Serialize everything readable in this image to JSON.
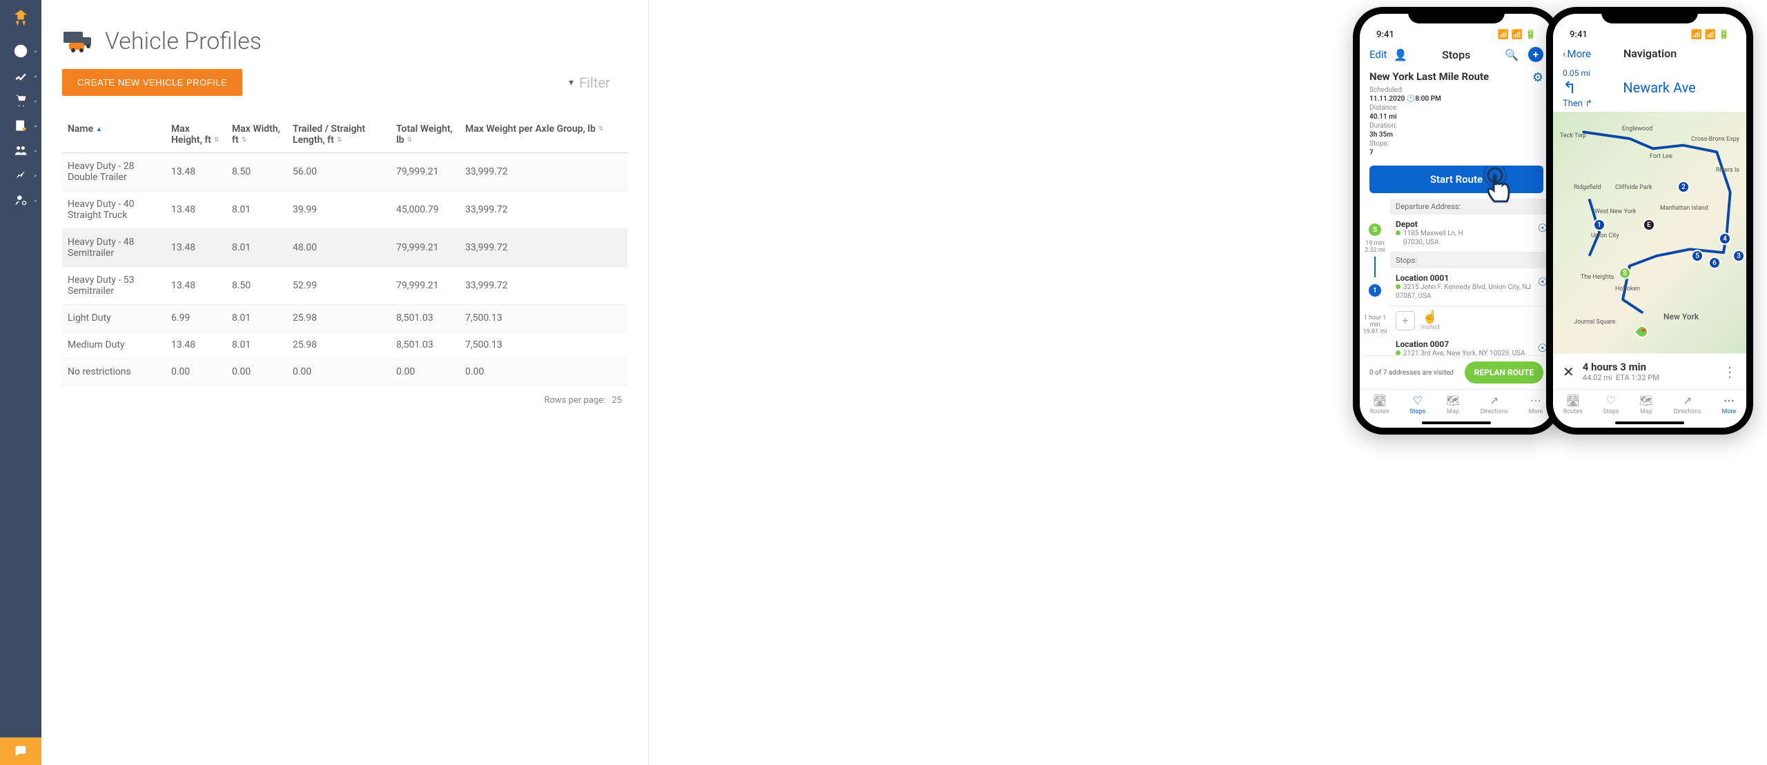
{
  "sidebar": {
    "items": [
      "help",
      "analytics",
      "cart",
      "book",
      "users",
      "trends",
      "user-settings"
    ]
  },
  "page": {
    "title": "Vehicle Profiles",
    "create_btn": "CREATE NEW VEHICLE PROFILE",
    "filter_placeholder": "Filter",
    "rows_per_page_label": "Rows per page:",
    "rows_per_page_value": "25"
  },
  "table": {
    "columns": [
      "Name",
      "Max Height, ft",
      "Max Width, ft",
      "Trailed / Straight Length, ft",
      "Total Weight, lb",
      "Max Weight per Axle Group, lb"
    ],
    "rows": [
      {
        "name": "Heavy Duty - 28 Double Trailer",
        "h": "13.48",
        "w": "8.50",
        "l": "56.00",
        "tw": "79,999.21",
        "aw": "33,999.72"
      },
      {
        "name": "Heavy Duty - 40 Straight Truck",
        "h": "13.48",
        "w": "8.01",
        "l": "39.99",
        "tw": "45,000.79",
        "aw": "33,999.72"
      },
      {
        "name": "Heavy Duty - 48 Semitrailer",
        "h": "13.48",
        "w": "8.01",
        "l": "48.00",
        "tw": "79,999.21",
        "aw": "33,999.72"
      },
      {
        "name": "Heavy Duty - 53 Semitrailer",
        "h": "13.48",
        "w": "8.50",
        "l": "52.99",
        "tw": "79,999.21",
        "aw": "33,999.72"
      },
      {
        "name": "Light Duty",
        "h": "6.99",
        "w": "8.01",
        "l": "25.98",
        "tw": "8,501.03",
        "aw": "7,500.13"
      },
      {
        "name": "Medium Duty",
        "h": "13.48",
        "w": "8.01",
        "l": "25.98",
        "tw": "8,501.03",
        "aw": "7,500.13"
      },
      {
        "name": "No restrictions",
        "h": "0.00",
        "w": "0.00",
        "l": "0.00",
        "tw": "0.00",
        "aw": "0.00"
      }
    ]
  },
  "phone1": {
    "time": "9:41",
    "edit": "Edit",
    "title": "Stops",
    "route_name": "New York Last Mile Route",
    "scheduled_label": "Scheduled:",
    "scheduled_date": "11.11.2020",
    "scheduled_time": "8:00 PM",
    "distance_label": "Distance:",
    "distance": "40.11 mi",
    "duration_label": "Duration:",
    "duration": "3h 35m",
    "stops_label": "Stops:",
    "stops_count": "7",
    "start_btn": "Start Route",
    "departure_hdr": "Departure Address:",
    "depot_name": "Depot",
    "depot_addr1": "1185 Maxwell Ln, H",
    "depot_addr2": "07030, USA",
    "tl1_time": "19 min",
    "tl1_dist": "2.52 mi",
    "tl2_time": "1 hour 1 min",
    "tl2_dist": "19.81 mi",
    "stops_hdr": "Stops:",
    "stop1_name": "Location 0001",
    "stop1_addr": "3215 John F. Kennedy Blvd, Union City, NJ 07087, USA",
    "visited": "Visited",
    "stop2_name": "Location 0007",
    "stop2_addr": "2121 3rd Ave, New York, NY 10029, USA",
    "footer_txt": "0 of 7 addresses are visited",
    "replan_btn": "REPLAN ROUTE",
    "tabs": [
      "Routes",
      "Stops",
      "Map",
      "Directions",
      "More"
    ]
  },
  "phone2": {
    "time": "9:41",
    "back": "More",
    "title": "Navigation",
    "step_dist": "0.05 mi",
    "step_road": "Newark Ave",
    "then": "Then",
    "trip_time": "4 hours 3 min",
    "trip_dist": "44.02 mi",
    "trip_eta": "ETA 1:32 PM",
    "tabs": [
      "Routes",
      "Stops",
      "Map",
      "Directions",
      "More"
    ],
    "map_labels": [
      "Englewood",
      "Fort Lee",
      "Ridgefield",
      "Cliffside Park",
      "West New York",
      "Manhattan Island",
      "Union City",
      "Hoboken",
      "New York",
      "Journal Square",
      "The Heights",
      "Cross-Bronx Expy",
      "Rikers Is",
      "Teck Twp"
    ]
  }
}
